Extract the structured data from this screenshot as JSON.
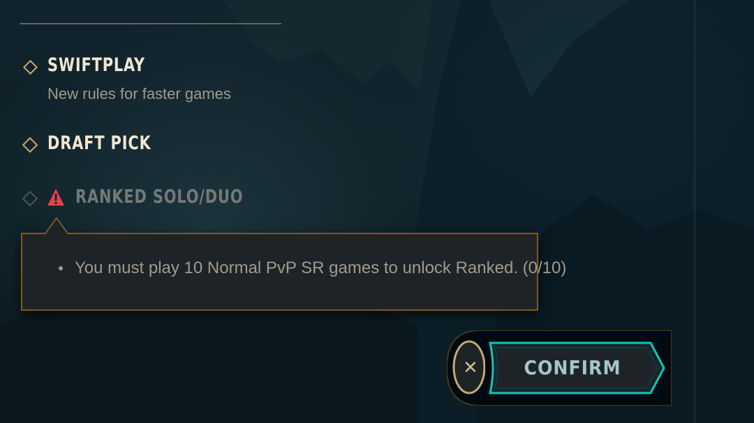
{
  "queue_modes": [
    {
      "title": "SWIFTPLAY",
      "subtitle": "New rules for faster games",
      "state": "selected"
    },
    {
      "title": "DRAFT PICK",
      "subtitle": "",
      "state": "available"
    },
    {
      "title": "RANKED SOLO/DUO",
      "subtitle": "",
      "state": "locked",
      "icon": "warning-icon"
    }
  ],
  "tooltip": {
    "message": "You must play 10 Normal PvP SR games to unlock Ranked. (0/10)"
  },
  "actions": {
    "cancel_glyph": "✕",
    "confirm_label": "CONFIRM"
  },
  "colors": {
    "gold": "#c8aa6e",
    "gold_dark": "#785a28",
    "text_light": "#f0e6d2",
    "text_muted": "#a09b8c",
    "disabled": "#737a78",
    "warning_red": "#e8404a",
    "confirm_teal": "#0ac8b9",
    "tooltip_bg": "#1e2328"
  }
}
